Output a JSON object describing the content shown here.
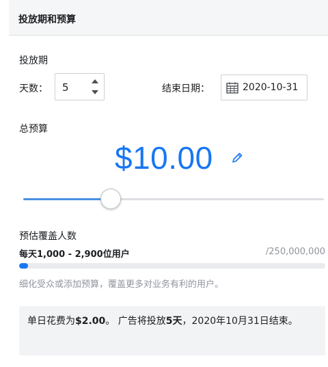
{
  "header": {
    "title": "投放期和预算"
  },
  "schedule": {
    "section_label": "投放期",
    "days_label": "天数：",
    "days_value": "5",
    "end_date_label": "结束日期：",
    "end_date_value": "2020-10-31"
  },
  "budget": {
    "section_label": "总预算",
    "amount": "$10.00",
    "slider_level": 0.29
  },
  "reach": {
    "label": "预估覆盖人数",
    "range": "每天1,000 - 2,900位用户",
    "total": "/250,000,000",
    "progress": 0.03,
    "hint": "细化受众或添加预算，覆盖更多对业务有利的用户。"
  },
  "summary": {
    "part1": "单日花费为",
    "daily_spend": "$2.00",
    "part2": "。 广告将投放",
    "duration": "5天",
    "part3": "，2020年10月31日结束。"
  },
  "colors": {
    "accent": "#1877f2",
    "slider_fill": "#4a90e2"
  }
}
